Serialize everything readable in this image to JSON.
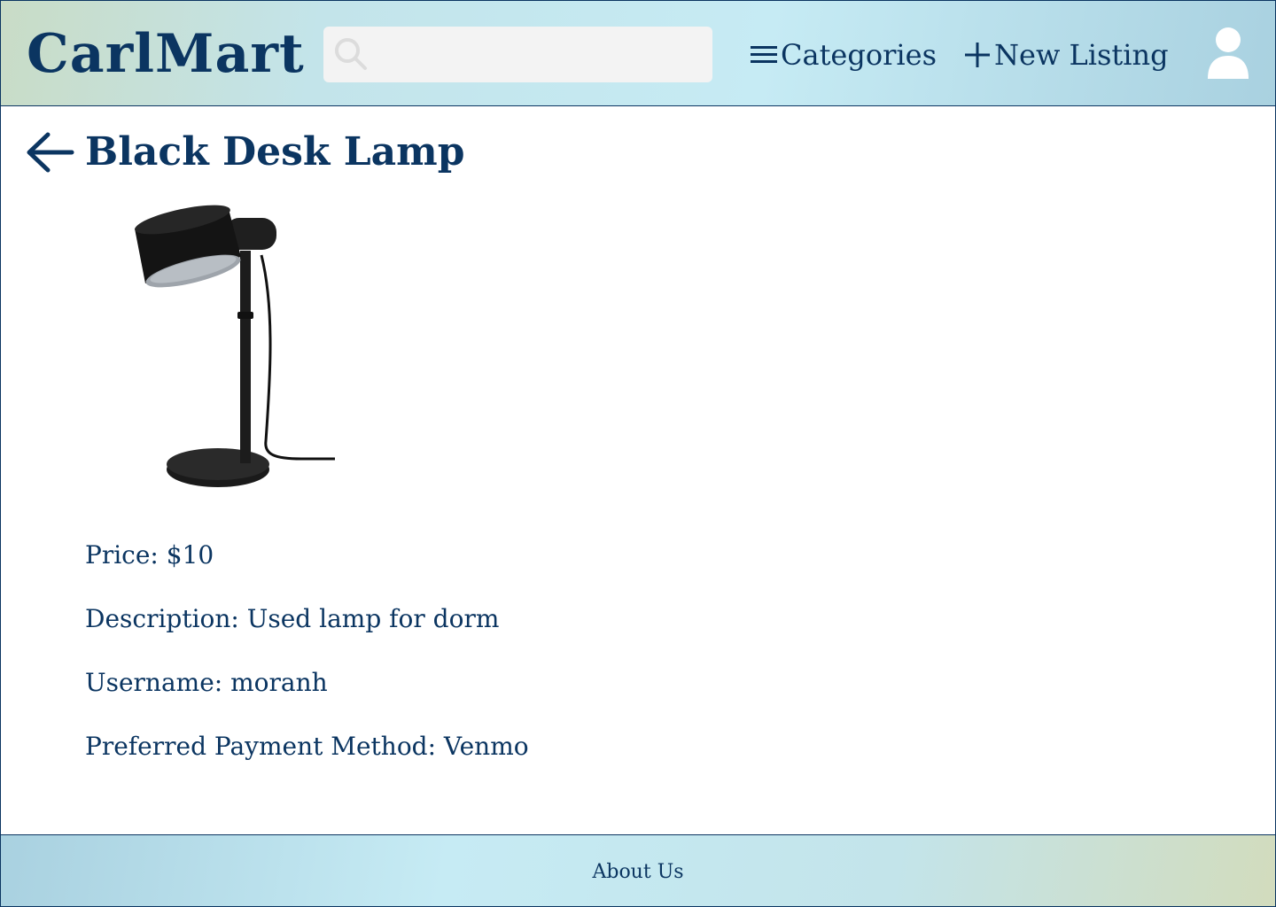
{
  "header": {
    "logo": "CarlMart",
    "search": {
      "placeholder": "",
      "value": "",
      "icon": "search-icon"
    },
    "nav": {
      "categories_label": "Categories",
      "categories_icon": "hamburger-menu-icon",
      "new_listing_label": "New Listing",
      "new_listing_icon": "plus-icon"
    },
    "profile_icon": "user-avatar-icon"
  },
  "listing": {
    "back_icon": "back-arrow-icon",
    "title": "Black Desk Lamp",
    "image": "desk-lamp-photo",
    "price": "Price: $10",
    "description": "Description: Used lamp for dorm",
    "username": "Username: moranh",
    "payment": "Preferred Payment Method: Venmo"
  },
  "footer": {
    "about_label": "About Us"
  },
  "colors": {
    "primary_text": "#0b3561",
    "search_bg": "#f3f3f3",
    "icon_gray": "#e9e9e9"
  }
}
